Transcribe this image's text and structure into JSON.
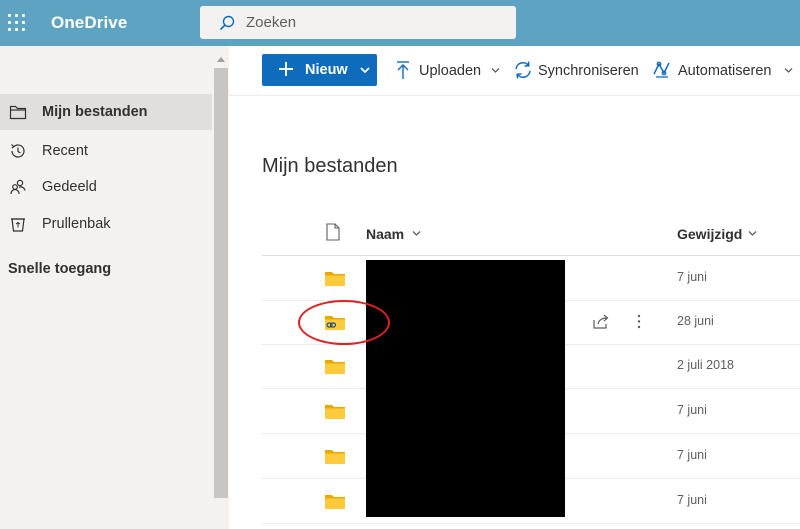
{
  "header": {
    "app_name": "OneDrive",
    "search_placeholder": "Zoeken",
    "bar_color": "#5ea4c2"
  },
  "sidebar": {
    "items": [
      {
        "label": "Mijn bestanden",
        "icon": "folder-icon",
        "active": true
      },
      {
        "label": "Recent",
        "icon": "clock-icon",
        "active": false
      },
      {
        "label": "Gedeeld",
        "icon": "people-icon",
        "active": false
      },
      {
        "label": "Prullenbak",
        "icon": "trash-icon",
        "active": false
      }
    ],
    "quick_access_label": "Snelle toegang"
  },
  "toolbar": {
    "new_label": "Nieuw",
    "upload_label": "Uploaden",
    "sync_label": "Synchroniseren",
    "automate_label": "Automatiseren",
    "accent_color": "#0f6cbd"
  },
  "main": {
    "title": "Mijn bestanden",
    "columns": {
      "name": "Naam",
      "modified": "Gewijzigd"
    },
    "rows": [
      {
        "icon": "folder-icon",
        "modified": "7 juni",
        "shared": false
      },
      {
        "icon": "shared-folder-icon",
        "modified": "28 juni",
        "shared": true
      },
      {
        "icon": "folder-icon",
        "modified": "2 juli 2018",
        "shared": false
      },
      {
        "icon": "folder-icon",
        "modified": "7 juni",
        "shared": false
      },
      {
        "icon": "folder-icon",
        "modified": "7 juni",
        "shared": false
      },
      {
        "icon": "folder-icon",
        "modified": "7 juni",
        "shared": false
      }
    ]
  }
}
